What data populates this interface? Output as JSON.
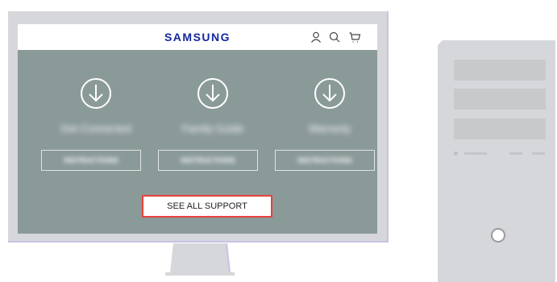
{
  "site": {
    "logo": "SAMSUNG",
    "header_icons": [
      "user-icon",
      "search-icon",
      "cart-icon"
    ]
  },
  "support_columns": [
    {
      "title": "Get Connected",
      "button": "INSTRUCTIONS",
      "icon": "download-icon"
    },
    {
      "title": "Family Guide",
      "button": "INSTRUCTIONS",
      "icon": "download-icon"
    },
    {
      "title": "Warranty",
      "button": "INSTRUCTIONS",
      "icon": "download-icon"
    }
  ],
  "see_all_support": "SEE ALL SUPPORT",
  "colors": {
    "brand": "#1428a0",
    "screen_bg": "#8a9a99",
    "highlight": "#e8413c",
    "monitor_frame": "#d6d7da",
    "tower": "#d6d7da"
  }
}
